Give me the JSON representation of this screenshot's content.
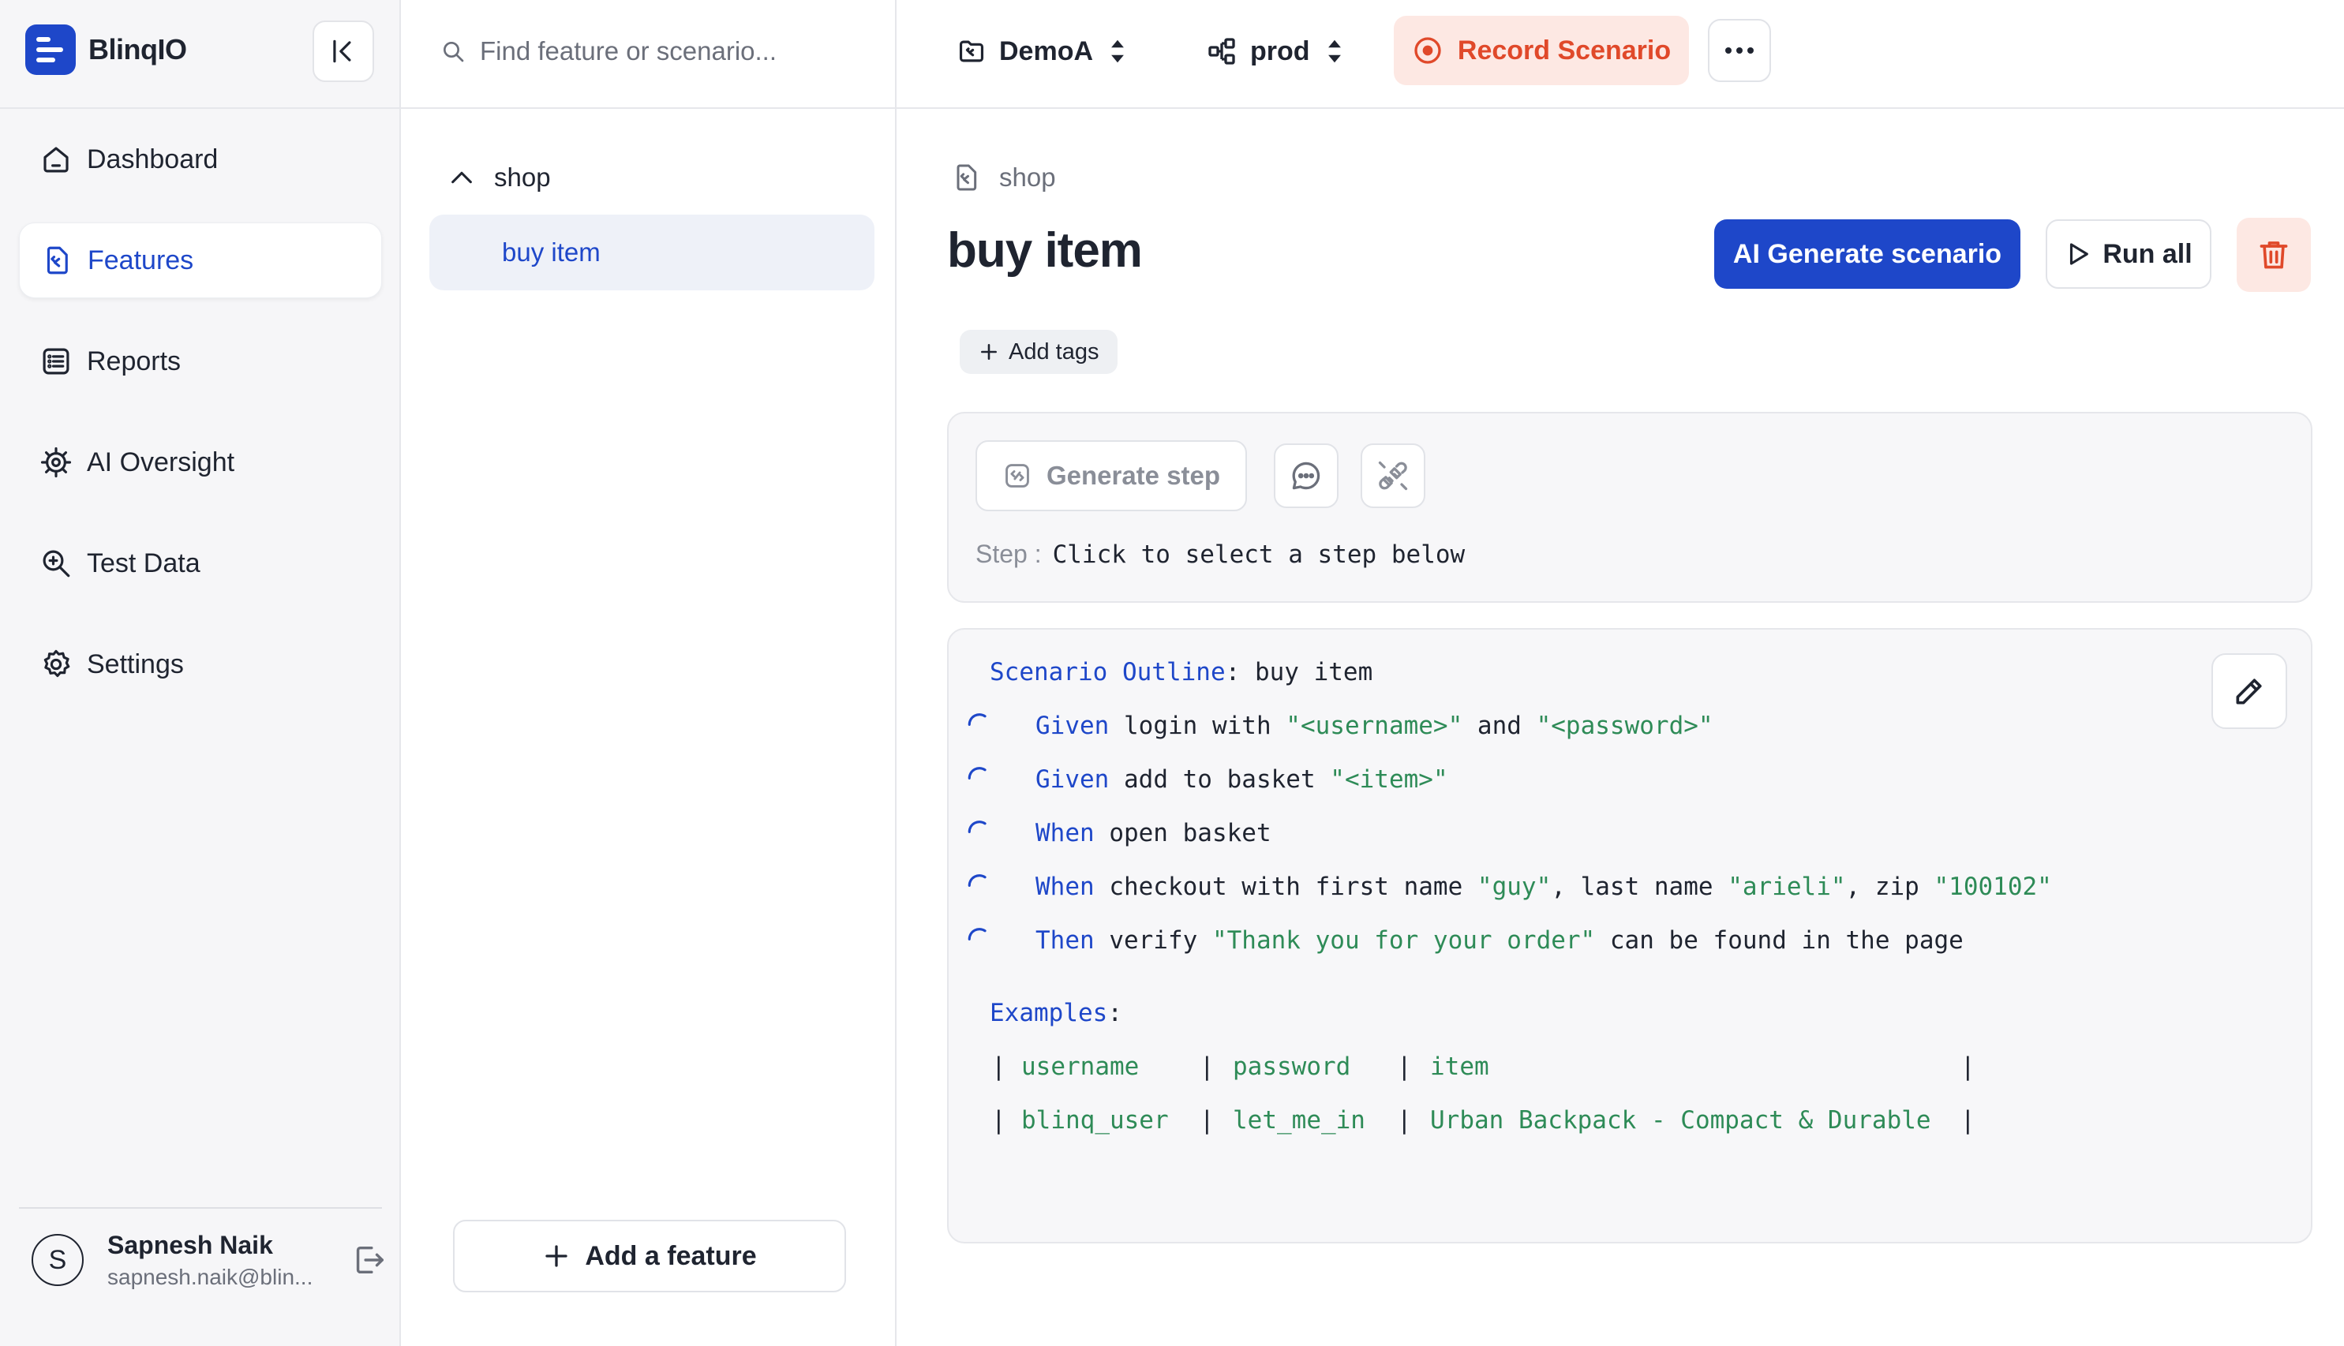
{
  "app": {
    "name": "BlinqIO"
  },
  "sidebar": {
    "items": [
      {
        "label": "Dashboard",
        "icon": "home-icon"
      },
      {
        "label": "Features",
        "icon": "feature-file-icon",
        "active": true
      },
      {
        "label": "Reports",
        "icon": "list-icon"
      },
      {
        "label": "AI Oversight",
        "icon": "cog-icon"
      },
      {
        "label": "Test Data",
        "icon": "search-data-icon"
      },
      {
        "label": "Settings",
        "icon": "settings-icon"
      }
    ],
    "user": {
      "initial": "S",
      "name": "Sapnesh Naik",
      "email": "sapnesh.naik@blin..."
    }
  },
  "features_panel": {
    "search_placeholder": "Find feature or scenario...",
    "group": "shop",
    "item": "buy item",
    "add_feature": "Add a feature"
  },
  "topbar": {
    "project": "DemoA",
    "environment": "prod",
    "record": "Record Scenario"
  },
  "main": {
    "breadcrumb": "shop",
    "title": "buy item",
    "ai_generate": "AI Generate scenario",
    "run_all": "Run all",
    "add_tags": "Add tags",
    "generate_step": "Generate step",
    "step_label": "Step",
    "step_separator": ":",
    "step_value": "Click to select a step below"
  },
  "scenario": {
    "outline_keyword": "Scenario Outline",
    "outline_colon": ": ",
    "outline_name": "buy item",
    "steps": [
      {
        "keyword": "Given",
        "parts": [
          [
            "t",
            " login with "
          ],
          [
            "s",
            "\"<username>\""
          ],
          [
            "t",
            " and "
          ],
          [
            "s",
            "\"<password>\""
          ]
        ]
      },
      {
        "keyword": "Given",
        "parts": [
          [
            "t",
            " add to basket "
          ],
          [
            "s",
            "\"<item>\""
          ]
        ]
      },
      {
        "keyword": "When",
        "parts": [
          [
            "t",
            " open basket"
          ]
        ]
      },
      {
        "keyword": "When",
        "parts": [
          [
            "t",
            " checkout with first name "
          ],
          [
            "s",
            "\"guy\""
          ],
          [
            "t",
            ", last name "
          ],
          [
            "s",
            "\"arieli\""
          ],
          [
            "t",
            ", zip "
          ],
          [
            "s",
            "\"100102\""
          ]
        ]
      },
      {
        "keyword": "Then",
        "parts": [
          [
            "t",
            " verify "
          ],
          [
            "s",
            "\"Thank you for your order\""
          ],
          [
            "t",
            " can be found in the page"
          ]
        ]
      }
    ],
    "examples_keyword": "Examples",
    "examples_colon": ":",
    "table": {
      "header": [
        "username",
        "password",
        "item"
      ],
      "rows": [
        [
          "blinq_user",
          "let_me_in",
          "Urban Backpack - Compact & Durable"
        ]
      ]
    }
  },
  "colors": {
    "brand": "#1e47c9",
    "record": "#e0492a",
    "string": "#2e8b57"
  }
}
